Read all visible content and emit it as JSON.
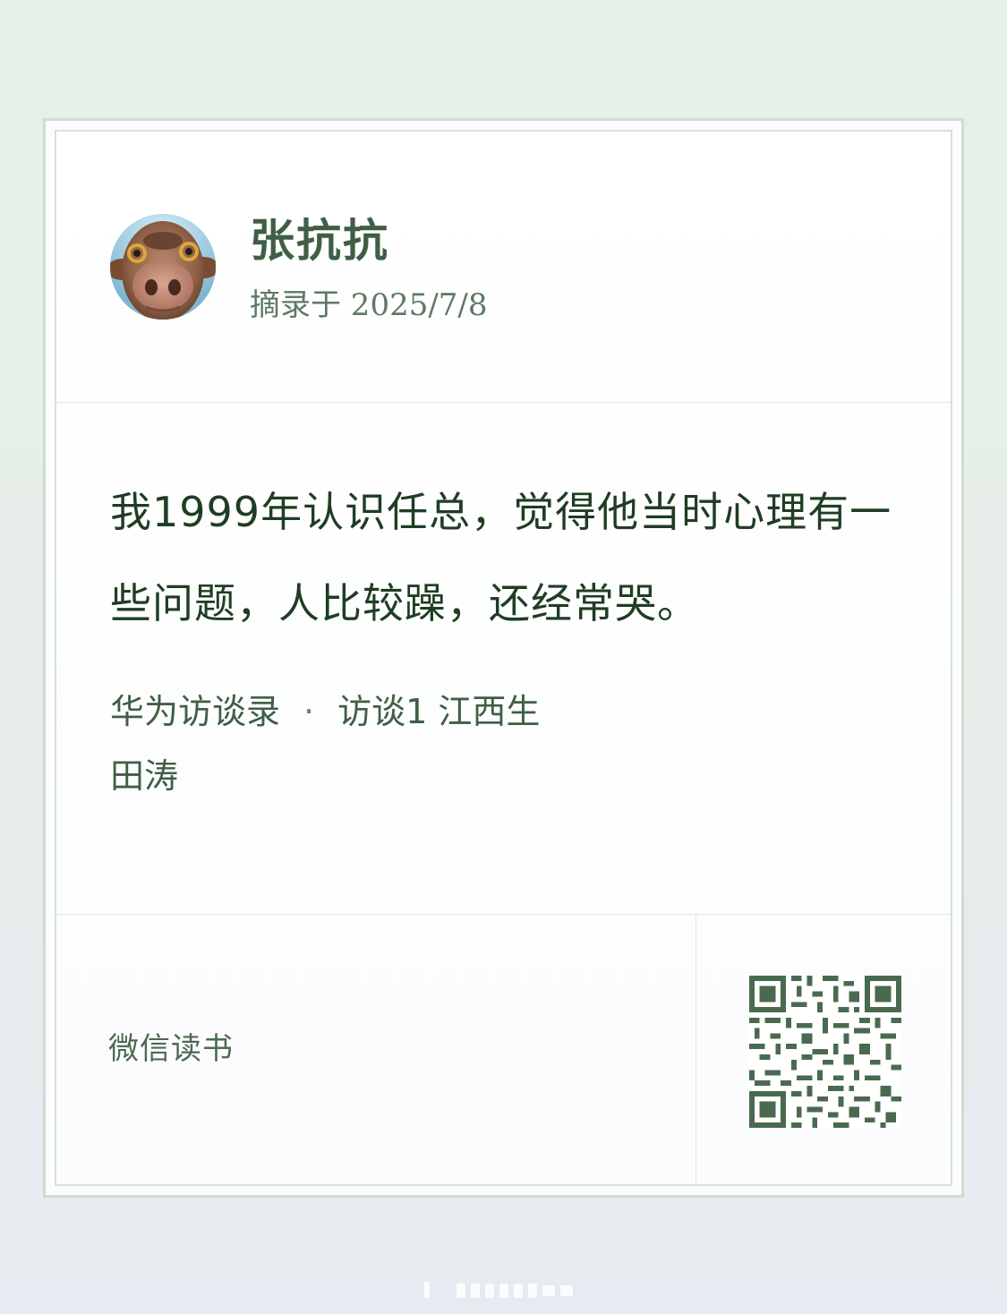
{
  "header": {
    "user_name": "张抗抗",
    "excerpt_date": "摘录于 2025/7/8"
  },
  "quote": {
    "text": "我1999年认识任总，觉得他当时心理有一些问题，人比较躁，还经常哭。",
    "book_title": "华为访谈录",
    "separator": "·",
    "chapter": "访谈1 江西生",
    "author": "田涛"
  },
  "footer": {
    "brand": "微信读书"
  },
  "colors": {
    "accent": "#3f5f45",
    "quote_text": "#1f3d22",
    "qr": "#4a6a50"
  },
  "icons": {
    "avatar": "cow-avatar",
    "qr": "qr-code-icon"
  }
}
